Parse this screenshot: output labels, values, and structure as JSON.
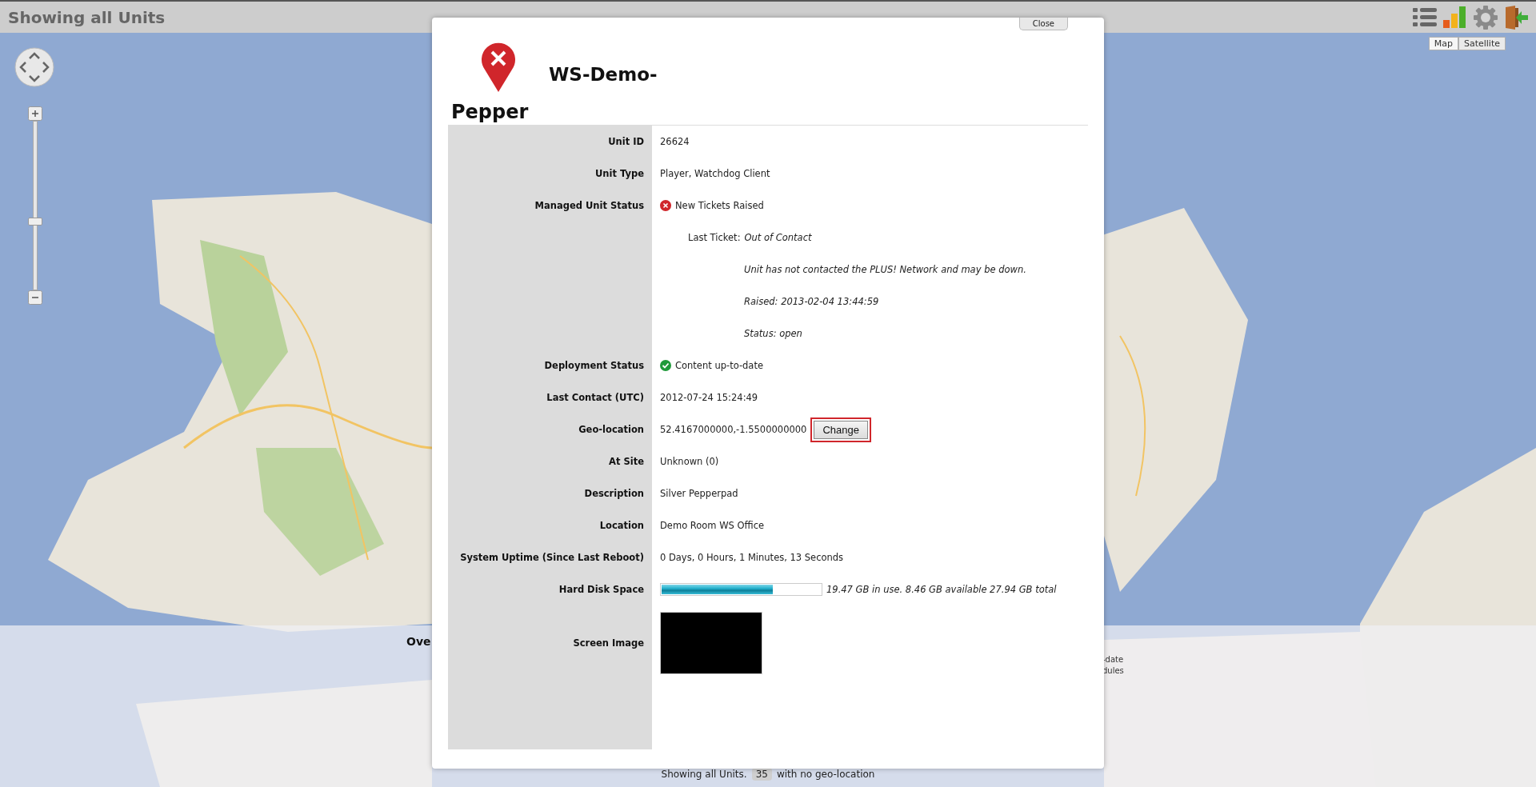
{
  "header": {
    "title": "Showing all Units"
  },
  "map_type": [
    {
      "label": "Map",
      "selected": true
    },
    {
      "label": "Satellite",
      "selected": false
    }
  ],
  "map_zoom": {
    "level": 0.4
  },
  "overview": {
    "heading": "Ove",
    "fragments": [
      "-date",
      "dules"
    ]
  },
  "dialog": {
    "close": "Close",
    "title": "WS-Demo-",
    "subtitle": "Pepper",
    "fields": [
      {
        "kind": "text",
        "label": "Unit ID",
        "value": "26624"
      },
      {
        "kind": "text",
        "label": "Unit Type",
        "value": "Player, Watchdog Client"
      },
      {
        "kind": "error",
        "label": "Managed Unit Status",
        "value": "New Tickets Raised",
        "ticket": {
          "label": "Last Ticket:",
          "title": "Out of Contact",
          "lines": [
            "Unit has not contacted the PLUS! Network and may be down.",
            "Raised: 2013-02-04 13:44:59",
            "Status: open"
          ]
        }
      },
      {
        "kind": "ok",
        "label": "Deployment Status",
        "value": "Content up-to-date"
      },
      {
        "kind": "text",
        "label": "Last Contact (UTC)",
        "value": "2012-07-24 15:24:49"
      },
      {
        "kind": "geo",
        "label": "Geo-location",
        "value": "52.4167000000,-1.5500000000",
        "button": "Change"
      },
      {
        "kind": "text",
        "label": "At Site",
        "value": "Unknown (0)"
      },
      {
        "kind": "text",
        "label": "Description",
        "value": "Silver Pepperpad"
      },
      {
        "kind": "text",
        "label": "Location",
        "value": "Demo Room WS Office"
      },
      {
        "kind": "text",
        "label": "System Uptime (Since Last Reboot)",
        "value": "0 Days, 0 Hours, 1 Minutes, 13 Seconds"
      },
      {
        "kind": "disk",
        "label": "Hard Disk Space",
        "level": 0.7,
        "value": "19.47 GB in use. 8.46 GB available 27.94 GB total"
      },
      {
        "label": "Screen Image"
      }
    ]
  },
  "footer": {
    "text": "Showing all Units.",
    "count": "35",
    "suffix": "with no geo-location"
  }
}
